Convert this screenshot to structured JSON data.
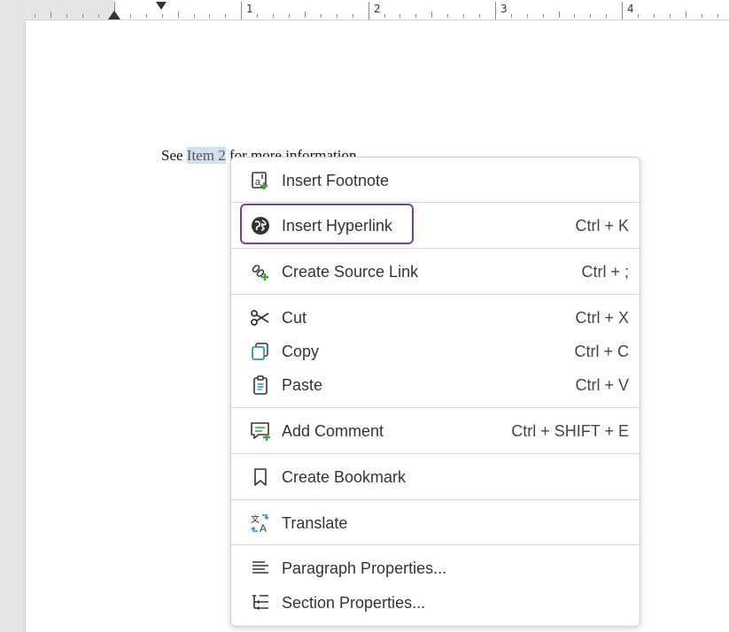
{
  "ruler": {
    "numbers": [
      "1",
      "2",
      "3",
      "4"
    ]
  },
  "document": {
    "before": "See ",
    "selected": "Item 2",
    "after": " for more information."
  },
  "menu": {
    "items": [
      {
        "label": "Insert Footnote",
        "shortcut": ""
      },
      {
        "label": "Insert Hyperlink",
        "shortcut": "Ctrl + K"
      },
      {
        "label": "Create Source Link",
        "shortcut": "Ctrl + ;"
      },
      {
        "label": "Cut",
        "shortcut": "Ctrl + X"
      },
      {
        "label": "Copy",
        "shortcut": "Ctrl + C"
      },
      {
        "label": "Paste",
        "shortcut": "Ctrl + V"
      },
      {
        "label": "Add Comment",
        "shortcut": "Ctrl + SHIFT + E"
      },
      {
        "label": "Create Bookmark",
        "shortcut": ""
      },
      {
        "label": "Translate",
        "shortcut": ""
      },
      {
        "label": "Paragraph Properties...",
        "shortcut": ""
      },
      {
        "label": "Section Properties...",
        "shortcut": ""
      }
    ],
    "focused_item": "Insert Hyperlink"
  },
  "colors": {
    "focus": "#7b3ea6",
    "green": "#3aa935",
    "blue": "#2d8fd8",
    "selection": "#cfe0f1"
  },
  "icons": [
    "footnote-icon",
    "globe-icon",
    "source-link-icon",
    "scissors-icon",
    "copy-icon",
    "clipboard-icon",
    "comment-icon",
    "bookmark-icon",
    "translate-icon",
    "paragraph-icon",
    "section-icon"
  ]
}
